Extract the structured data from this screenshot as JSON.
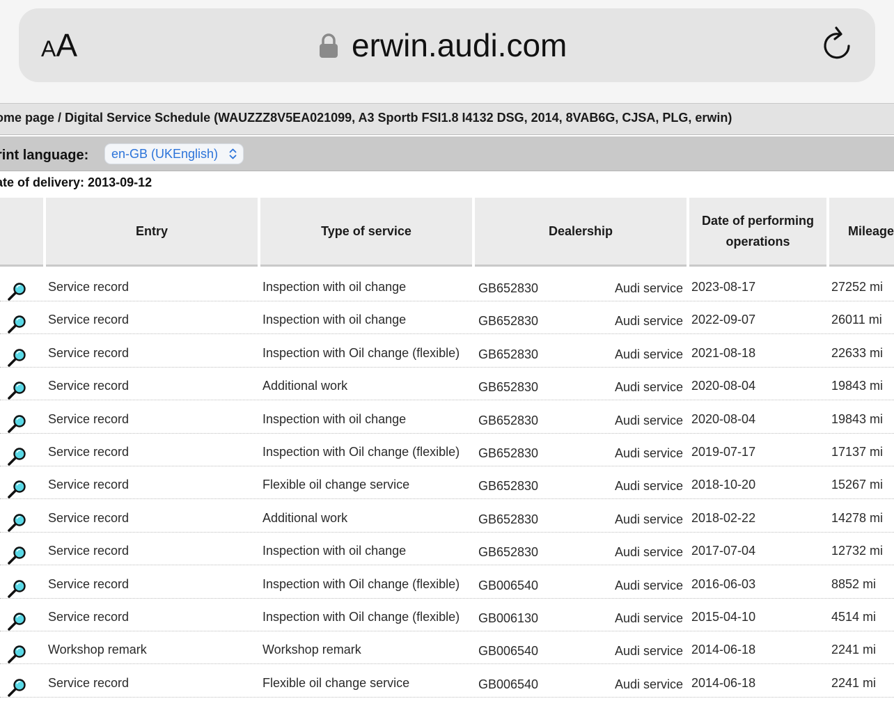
{
  "browser": {
    "text_size_label_small": "A",
    "text_size_label_large": "A",
    "url": "erwin.audi.com"
  },
  "breadcrumb": "ome page / Digital Service Schedule (WAUZZZ8V5EA021099, A3 Sportb FSI1.8 I4132 DSG, 2014, 8VAB6G, CJSA, PLG, erwin)",
  "print_language": {
    "label": "rint language:",
    "selected": "en-GB (UKEnglish)"
  },
  "delivery": "ate of delivery: 2013-09-12",
  "table": {
    "headers": {
      "entry": "Entry",
      "type": "Type of service",
      "dealer": "Dealership",
      "date_line1": "Date of performing",
      "date_line2": "operations",
      "mileage": "Mileage"
    },
    "rows": [
      {
        "entry": "Service record",
        "type": "Inspection with oil change",
        "dealer_code": "GB652830",
        "dealer_name": "Audi service",
        "date": "2023-08-17",
        "mileage": "27252 mi"
      },
      {
        "entry": "Service record",
        "type": "Inspection with oil change",
        "dealer_code": "GB652830",
        "dealer_name": "Audi service",
        "date": "2022-09-07",
        "mileage": "26011 mi"
      },
      {
        "entry": "Service record",
        "type": "Inspection with Oil change (flexible)",
        "dealer_code": "GB652830",
        "dealer_name": "Audi service",
        "date": "2021-08-18",
        "mileage": "22633 mi"
      },
      {
        "entry": "Service record",
        "type": "Additional work",
        "dealer_code": "GB652830",
        "dealer_name": "Audi service",
        "date": "2020-08-04",
        "mileage": "19843 mi"
      },
      {
        "entry": "Service record",
        "type": "Inspection with oil change",
        "dealer_code": "GB652830",
        "dealer_name": "Audi service",
        "date": "2020-08-04",
        "mileage": "19843 mi"
      },
      {
        "entry": "Service record",
        "type": "Inspection with Oil change (flexible)",
        "dealer_code": "GB652830",
        "dealer_name": "Audi service",
        "date": "2019-07-17",
        "mileage": "17137 mi"
      },
      {
        "entry": "Service record",
        "type": "Flexible oil change service",
        "dealer_code": "GB652830",
        "dealer_name": "Audi service",
        "date": "2018-10-20",
        "mileage": "15267 mi"
      },
      {
        "entry": "Service record",
        "type": "Additional work",
        "dealer_code": "GB652830",
        "dealer_name": "Audi service",
        "date": "2018-02-22",
        "mileage": "14278 mi"
      },
      {
        "entry": "Service record",
        "type": "Inspection with oil change",
        "dealer_code": "GB652830",
        "dealer_name": "Audi service",
        "date": "2017-07-04",
        "mileage": "12732 mi"
      },
      {
        "entry": "Service record",
        "type": "Inspection with Oil change (flexible)",
        "dealer_code": "GB006540",
        "dealer_name": "Audi service",
        "date": "2016-06-03",
        "mileage": "8852 mi"
      },
      {
        "entry": "Service record",
        "type": "Inspection with Oil change (flexible)",
        "dealer_code": "GB006130",
        "dealer_name": "Audi service",
        "date": "2015-04-10",
        "mileage": "4514 mi"
      },
      {
        "entry": "Workshop remark",
        "type": "Workshop remark",
        "dealer_code": "GB006540",
        "dealer_name": "Audi service",
        "date": "2014-06-18",
        "mileage": "2241 mi"
      },
      {
        "entry": "Service record",
        "type": "Flexible oil change service",
        "dealer_code": "GB006540",
        "dealer_name": "Audi service",
        "date": "2014-06-18",
        "mileage": "2241 mi"
      }
    ]
  },
  "icons": {
    "lock": "lock-icon",
    "reload": "reload-icon",
    "row_detail": "magnifier-icon",
    "select": "chevron-up-down-icon"
  },
  "colors": {
    "link_blue": "#2b73d9",
    "magnifier_lens": "#5ad8e6",
    "header_bg": "#ebebeb"
  }
}
